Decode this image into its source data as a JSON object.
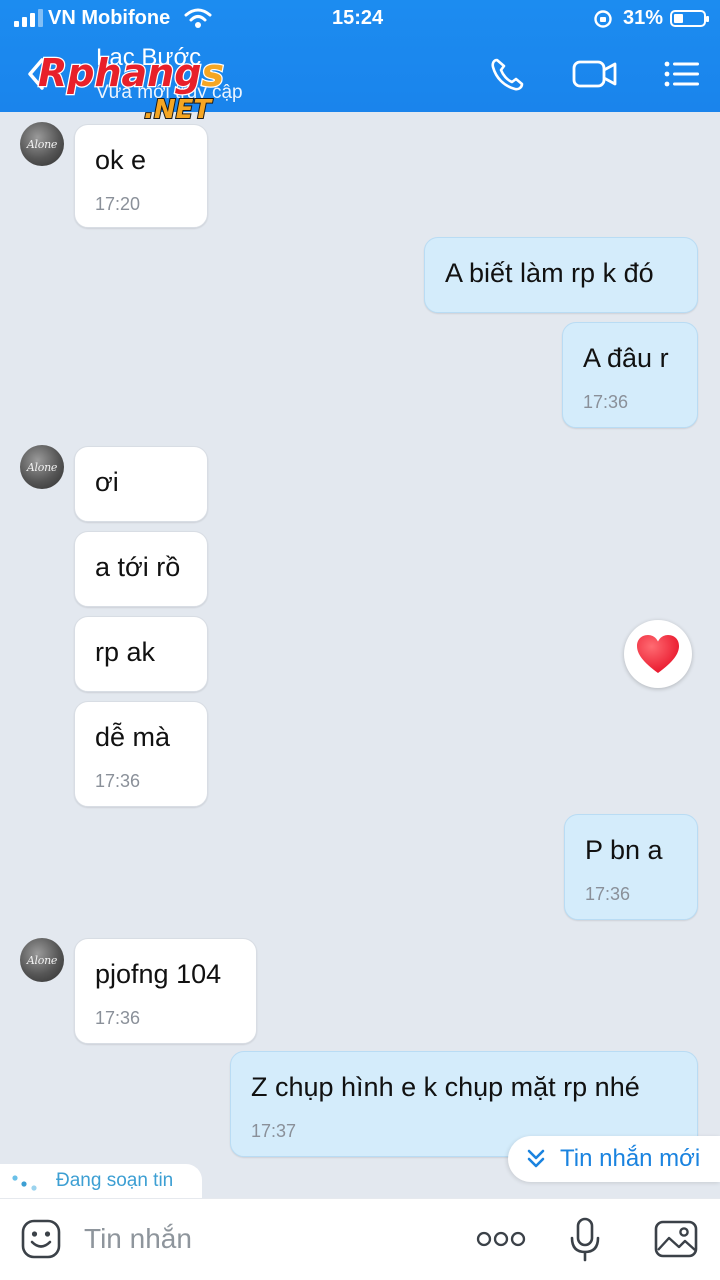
{
  "status_bar": {
    "carrier": "VN Mobifone",
    "time": "15:24",
    "battery": "31%",
    "battery_level": 0.31
  },
  "header": {
    "contact_name": "Lạc Bước",
    "contact_status": "Vừa mới truy cập",
    "watermark_main": "Rphangs",
    "watermark_sub": ".NET",
    "icons": [
      "back-icon",
      "phone-icon",
      "video-call-icon",
      "menu-icon"
    ]
  },
  "contact_avatar_text": "Alone",
  "messages": [
    {
      "side": "in",
      "text": "ok e",
      "time": "17:20"
    },
    {
      "side": "out",
      "text": "A biết làm rp k đó",
      "time": ""
    },
    {
      "side": "out",
      "text": "A đâu r",
      "time": "17:36"
    },
    {
      "side": "in",
      "text": "ơi",
      "time": ""
    },
    {
      "side": "in",
      "text": "a tới rồ",
      "time": ""
    },
    {
      "side": "in",
      "text": "rp ak",
      "time": ""
    },
    {
      "side": "in",
      "text": "dễ mà",
      "time": "17:36"
    },
    {
      "side": "out",
      "text": "P bn a",
      "time": "17:36"
    },
    {
      "side": "in",
      "text": "pjofng 104",
      "time": "17:36"
    },
    {
      "side": "out",
      "text": "Z chụp hình e k chụp mặt rp nhé",
      "time": "17:37"
    }
  ],
  "reaction_icon": "heart-icon",
  "new_message_button": "Tin nhắn mới",
  "typing_indicator": "Đang soạn tin",
  "input": {
    "placeholder": "Tin nhắn",
    "icons": [
      "emoji-icon",
      "more-icon",
      "microphone-icon",
      "gallery-icon"
    ]
  },
  "colors": {
    "header": "#1c8cf0",
    "incoming_bubble": "#ffffff",
    "outgoing_bubble": "#d4ecfb",
    "chat_background": "#e3e8ef",
    "accent": "#1a83df"
  }
}
